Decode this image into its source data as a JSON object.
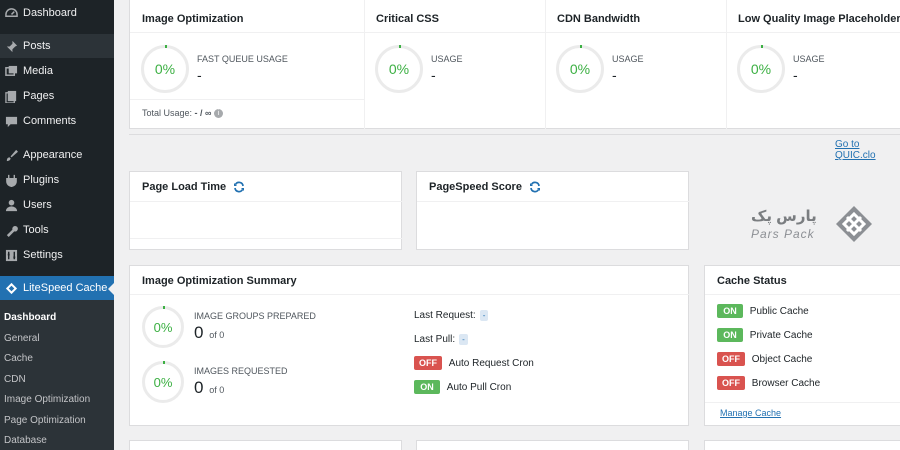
{
  "sidebar": {
    "items": [
      {
        "label": "Dashboard",
        "icon": "dashboard-icon"
      },
      {
        "label": "Posts",
        "icon": "pin-icon"
      },
      {
        "label": "Media",
        "icon": "media-icon"
      },
      {
        "label": "Pages",
        "icon": "pages-icon"
      },
      {
        "label": "Comments",
        "icon": "comments-icon"
      },
      {
        "label": "Appearance",
        "icon": "brush-icon"
      },
      {
        "label": "Plugins",
        "icon": "plugin-icon"
      },
      {
        "label": "Users",
        "icon": "users-icon"
      },
      {
        "label": "Tools",
        "icon": "wrench-icon"
      },
      {
        "label": "Settings",
        "icon": "settings-icon"
      },
      {
        "label": "LiteSpeed Cache",
        "icon": "litespeed-icon"
      }
    ],
    "submenu": [
      "Dashboard",
      "General",
      "Cache",
      "CDN",
      "Image Optimization",
      "Page Optimization",
      "Database"
    ]
  },
  "top_panels": {
    "image_optimization": {
      "title": "Image Optimization",
      "percent": "0%",
      "label": "FAST QUEUE USAGE",
      "value": "-",
      "total_label": "Total Usage:",
      "total_value": "- / ∞"
    },
    "critical_css": {
      "title": "Critical CSS",
      "percent": "0%",
      "label": "USAGE",
      "value": "-"
    },
    "cdn_bandwidth": {
      "title": "CDN Bandwidth",
      "percent": "0%",
      "label": "USAGE",
      "value": "-"
    },
    "lqip": {
      "title": "Low Quality Image Placeholder",
      "percent": "0%",
      "label": "USAGE",
      "value": "-"
    }
  },
  "quic_link": "Go to QUIC.clo",
  "page_load_time": {
    "title": "Page Load Time"
  },
  "pagespeed_score": {
    "title": "PageSpeed Score"
  },
  "logo": {
    "text_fa": "پارس پک",
    "text_en": "Pars Pack"
  },
  "summary": {
    "title": "Image Optimization Summary",
    "groups": {
      "percent": "0%",
      "label": "IMAGE GROUPS PREPARED",
      "value": "0",
      "of": "of 0"
    },
    "requested": {
      "percent": "0%",
      "label": "IMAGES REQUESTED",
      "value": "0",
      "of": "of 0"
    },
    "last_request_label": "Last Request:",
    "last_request_value": "-",
    "last_pull_label": "Last Pull:",
    "last_pull_value": "-",
    "auto_request": {
      "state": "OFF",
      "label": "Auto Request Cron"
    },
    "auto_pull": {
      "state": "ON",
      "label": "Auto Pull Cron"
    }
  },
  "cache_status": {
    "title": "Cache Status",
    "rows": [
      {
        "state": "ON",
        "label": "Public Cache"
      },
      {
        "state": "ON",
        "label": "Private Cache"
      },
      {
        "state": "OFF",
        "label": "Object Cache"
      },
      {
        "state": "OFF",
        "label": "Browser Cache"
      }
    ],
    "manage_link": "Manage Cache"
  },
  "colors": {
    "on": "#5cb85c",
    "off": "#d9534f",
    "accent": "#2271b1",
    "ring": "#3cb043"
  }
}
